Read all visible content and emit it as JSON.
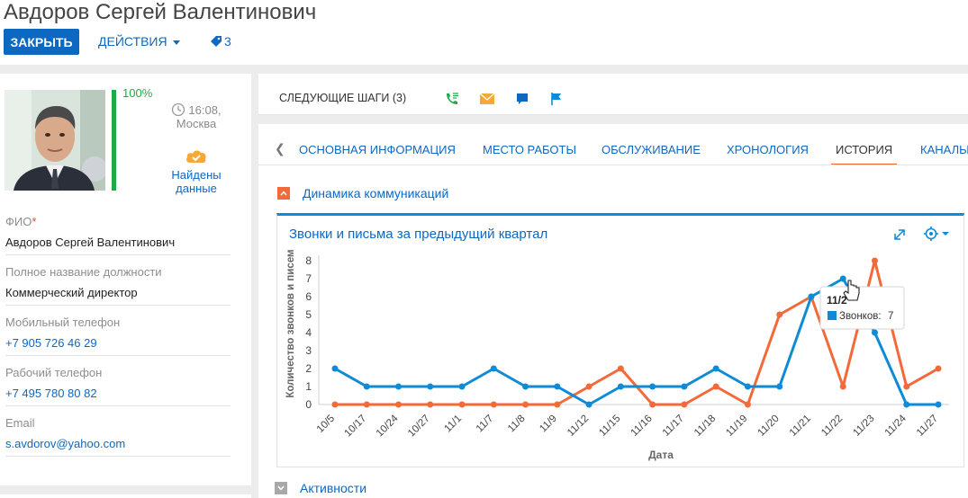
{
  "header": {
    "title": "Авдоров Сергей Валентинович",
    "close_label": "ЗАКРЫТЬ",
    "actions_label": "ДЕЙСТВИЯ",
    "tag_count": "3"
  },
  "profile": {
    "completeness": "100%",
    "completeness_value": 1.0,
    "time": "16:08,",
    "city": "Москва",
    "found_line1": "Найдены",
    "found_line2": "данные"
  },
  "fields": [
    {
      "label": "ФИО",
      "required_mark": "*",
      "value": "Авдоров Сергей Валентинович"
    },
    {
      "label": "Полное название должности",
      "value": "Коммерческий директор"
    },
    {
      "label": "Мобильный телефон",
      "value": "+7 905 726 46 29"
    },
    {
      "label": "Рабочий телефон",
      "value": "+7 495 780 80 82"
    },
    {
      "label": "Email",
      "value": "s.avdorov@yahoo.com"
    }
  ],
  "next_steps": {
    "label": "СЛЕДУЮЩИЕ ШАГИ (3)"
  },
  "tabs": [
    "ОСНОВНАЯ ИНФОРМАЦИЯ",
    "МЕСТО РАБОТЫ",
    "ОБСЛУЖИВАНИЕ",
    "ХРОНОЛОГИЯ",
    "ИСТОРИЯ",
    "КАНАЛЫ"
  ],
  "active_tab": "ИСТОРИЯ",
  "section1": {
    "title": "Динамика коммуникаций"
  },
  "section2": {
    "title": "Активности"
  },
  "dashboard": {
    "title": "Звонки и письма за предыдущий квартал"
  },
  "tooltip": {
    "x_label": "11/2",
    "series_label": "Звонков:",
    "value": "7"
  },
  "colors": {
    "accent": "#0d68c2",
    "calls": "#0d8bd6",
    "emails": "#f26a3a",
    "progress": "#1faa48"
  },
  "chart_data": {
    "type": "line",
    "title": "",
    "xlabel": "Дата",
    "ylabel": "Количество звонков и писем",
    "ylim": [
      0,
      8
    ],
    "yticks": [
      0,
      1,
      2,
      3,
      4,
      5,
      6,
      7,
      8
    ],
    "grid": false,
    "categories": [
      "10/5",
      "10/17",
      "10/24",
      "10/27",
      "11/1",
      "11/7",
      "11/8",
      "11/9",
      "11/12",
      "11/15",
      "11/16",
      "11/17",
      "11/18",
      "11/19",
      "11/20",
      "11/21",
      "11/22",
      "11/23",
      "11/24",
      "11/27"
    ],
    "series": [
      {
        "name": "Звонков",
        "color": "#0d8bd6",
        "values": [
          2,
          1,
          1,
          1,
          1,
          2,
          1,
          1,
          0,
          1,
          1,
          1,
          2,
          1,
          1,
          6,
          7,
          4,
          0,
          0
        ]
      },
      {
        "color": "#f26a3a",
        "values": [
          0,
          0,
          0,
          0,
          0,
          0,
          0,
          0,
          1,
          2,
          0,
          0,
          1,
          0,
          5,
          6,
          1,
          8,
          1,
          2
        ]
      }
    ]
  }
}
